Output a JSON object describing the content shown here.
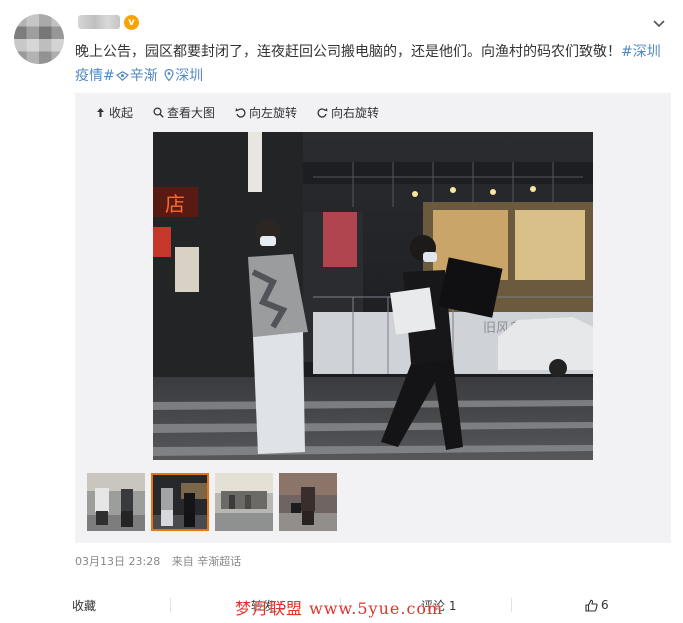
{
  "post": {
    "text_main": "晚上公告，园区都要封闭了，连夜赶回公司搬电脑的，还是他们。向渔村的码农们致敬！",
    "hashtag": "#深圳疫情#",
    "mention": "辛渐",
    "location": "深圳"
  },
  "toolbar": {
    "collapse": "收起",
    "view_large": "查看大图",
    "rotate_left": "向左旋转",
    "rotate_right": "向右旋转"
  },
  "photo": {
    "shop_sign": "店",
    "wall_text": "旧风乌伐"
  },
  "meta": {
    "time": "03月13日 23:28",
    "source": "来自 辛渐超话"
  },
  "actions": {
    "favorite": "收藏",
    "repost": "转发 5",
    "comment": "评论 1",
    "like_count": "6"
  },
  "watermark": "梦月联盟 www.5yue.com",
  "colors": {
    "link": "#5289c2",
    "verified": "#f7a400",
    "active_thumb_border": "#e87412",
    "watermark": "#e0332b"
  },
  "icons": [
    "verified-icon",
    "chevron-down-icon",
    "collapse-arrow-icon",
    "magnifier-icon",
    "rotate-left-icon",
    "rotate-right-icon",
    "location-pin-icon",
    "thumbs-up-icon"
  ]
}
